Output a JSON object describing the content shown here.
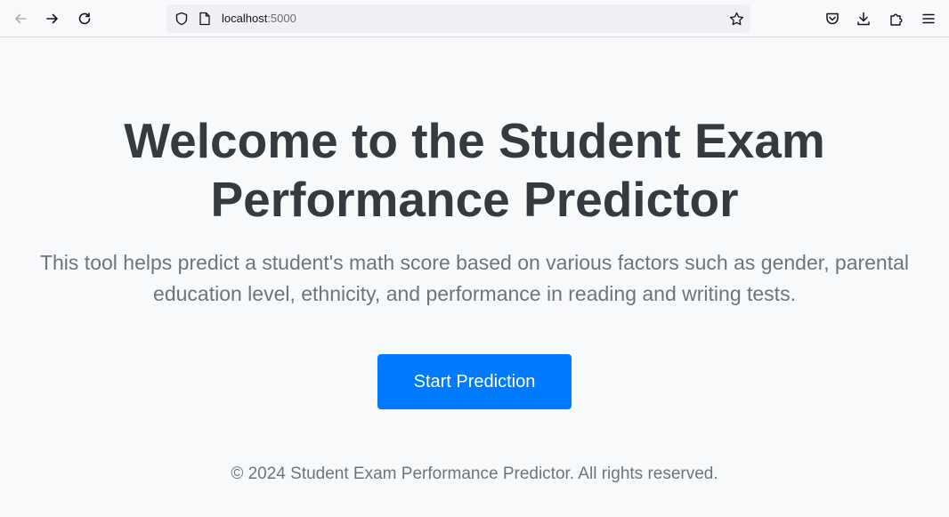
{
  "browser": {
    "url_host": "localhost",
    "url_port": ":5000",
    "icons": {
      "back": "arrow-left-icon",
      "forward": "arrow-right-icon",
      "reload": "reload-icon",
      "shield": "shield-icon",
      "page": "page-icon",
      "bookmark": "star-icon",
      "pocket": "pocket-icon",
      "downloads": "download-icon",
      "extensions": "puzzle-icon",
      "menu": "hamburger-menu-icon"
    }
  },
  "page": {
    "title": "Welcome to the Student Exam Performance Predictor",
    "description": "This tool helps predict a student's math score based on various factors such as gender, parental education level, ethnicity, and performance in reading and writing tests.",
    "cta_label": "Start Prediction",
    "footer": "© 2024 Student Exam Performance Predictor. All rights reserved."
  },
  "colors": {
    "background": "#f8f9fa",
    "heading": "#343a40",
    "muted_text": "#6c757d",
    "primary_button": "#007bff"
  }
}
